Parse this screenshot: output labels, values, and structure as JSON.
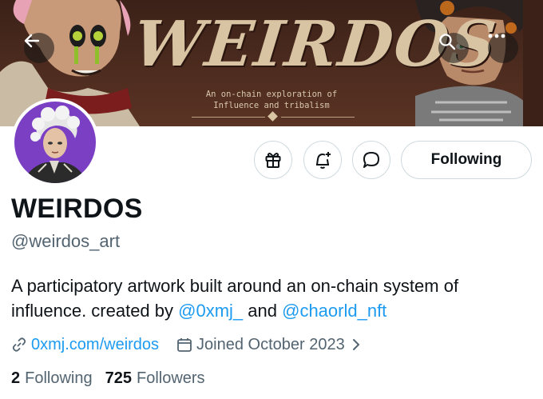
{
  "banner": {
    "title": "WEIRDOS",
    "subtitle_line1": "An on-chain exploration of",
    "subtitle_line2": "Influence and tribalism"
  },
  "nav": {
    "back_icon": "arrow-left-icon",
    "search_icon": "search-icon",
    "more_icon": "more-horizontal-icon"
  },
  "actions": {
    "gift_icon": "gift-icon",
    "notify_icon": "bell-plus-icon",
    "message_icon": "message-bubble-icon",
    "follow_label": "Following"
  },
  "profile": {
    "display_name": "WEIRDOS",
    "handle": "@weirdos_art",
    "bio_line1": "A participatory artwork built around an on-chain system of",
    "bio_prefix": "influence. created by ",
    "mention1": "@0xmj_",
    "bio_and": " and ",
    "mention2": "@chaorld_nft",
    "link": "0xmj.com/weirdos",
    "joined": "Joined October 2023"
  },
  "stats": {
    "following_count": "2",
    "following_label": "Following",
    "followers_count": "725",
    "followers_label": "Followers"
  },
  "colors": {
    "accent": "#1d9bf0",
    "text": "#0f1419",
    "muted": "#536471",
    "avatar_bg": "#7b3fc4"
  }
}
